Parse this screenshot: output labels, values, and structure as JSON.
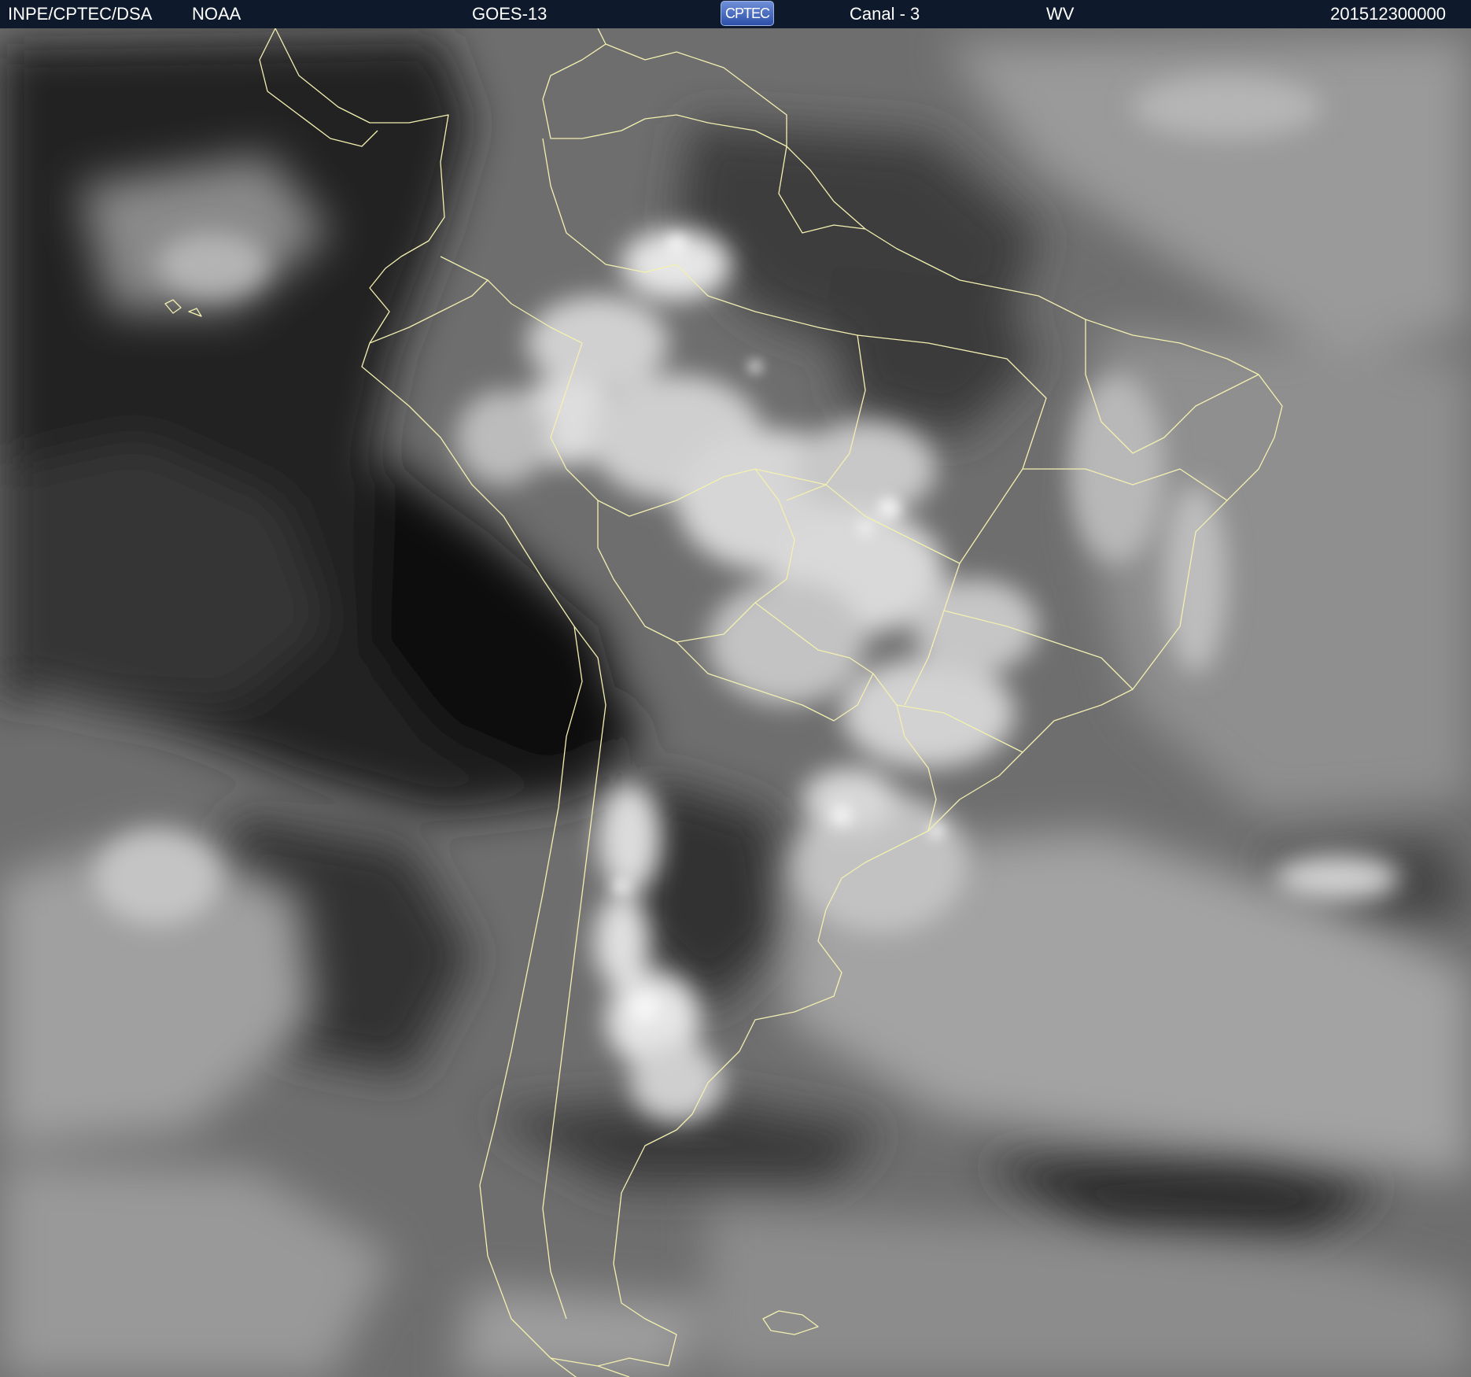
{
  "header": {
    "organization": "INPE/CPTEC/DSA",
    "agency": "NOAA",
    "satellite": "GOES-13",
    "logo_text": "CPTEC",
    "channel": "Canal - 3",
    "band": "WV",
    "timestamp": "201512300000"
  },
  "map": {
    "imagery": "water-vapor satellite image",
    "region": "South America",
    "border_color": "#f3f0b0",
    "header_background": "#0e1a2b",
    "logo_color": "#3a5fc0"
  }
}
